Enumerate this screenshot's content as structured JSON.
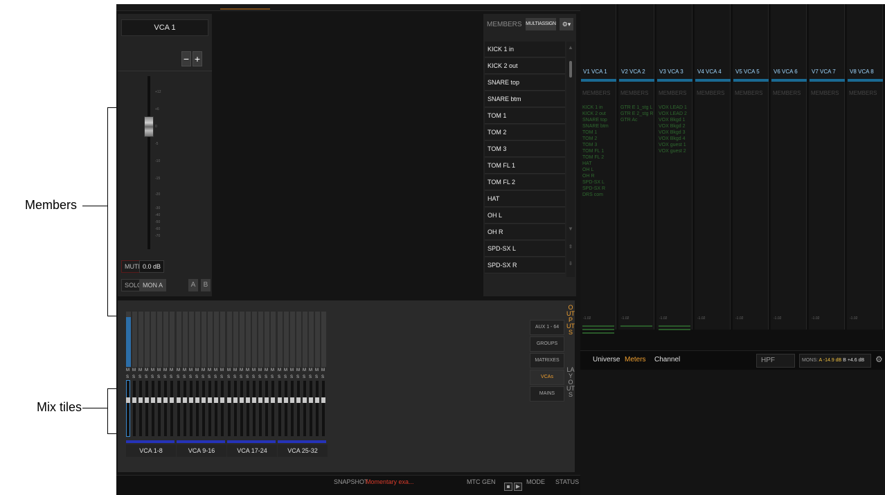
{
  "annotations": {
    "members_label": "Members",
    "mix_tiles_label": "Mix tiles"
  },
  "vca_panel": {
    "name": "VCA 1",
    "minus": "−",
    "plus": "+",
    "mute_label": "MUTE",
    "level": "0.0 dB",
    "solo_label": "SOLO",
    "mon_label": "MON A",
    "a_label": "A",
    "b_label": "B"
  },
  "members_panel": {
    "title": "MEMBERS",
    "multiassign": "MULTIASSIGN",
    "gear": "⚙▾",
    "items": [
      "KICK 1 in",
      "KICK 2 out",
      "SNARE top",
      "SNARE btm",
      "TOM 1",
      "TOM 2",
      "TOM 3",
      "TOM FL 1",
      "TOM FL 2",
      "HAT",
      "OH L",
      "OH R",
      "SPD-SX L",
      "SPD-SX R"
    ]
  },
  "vca_strips": [
    {
      "head": "V1  VCA 1",
      "members": [
        "KICK 1 in",
        "KICK 2 out",
        "SNARE top",
        "SNARE btm",
        "TOM 1",
        "TOM 2",
        "TOM 3",
        "TOM FL 1",
        "TOM FL 2",
        "HAT",
        "OH L",
        "OH R",
        "SPD-SX L",
        "SPD-SX R",
        "DRS com"
      ]
    },
    {
      "head": "V2  VCA 2",
      "members": [
        "GTR E 1_stg L",
        "GTR E 2_stg R",
        "GTR Ac"
      ]
    },
    {
      "head": "V3  VCA 3",
      "members": [
        "VOX LEAD 1",
        "VOX LEAD 2",
        "VOX Bkgd 1",
        "VOX Bkgd 2",
        "VOX Bkgd 3",
        "VOX Bkgd 4",
        "VOX guest 1",
        "VOX guest 2"
      ]
    },
    {
      "head": "V4  VCA 4",
      "members": []
    },
    {
      "head": "V5  VCA 5",
      "members": []
    },
    {
      "head": "V6  VCA 6",
      "members": []
    },
    {
      "head": "V7  VCA 7",
      "members": []
    },
    {
      "head": "V8  VCA 8",
      "members": []
    }
  ],
  "strip_members_label": "MEMBERS",
  "strip_gain": "-1.02",
  "view_bar": {
    "universe": "Universe",
    "meters": "Meters",
    "channel": "Channel",
    "hpf": "HPF",
    "mons_label": "MONS:",
    "mon_a": "A",
    "mon_a_val": "-14.9 dB",
    "mon_b": "B",
    "mon_b_val": "+4.6 dB",
    "gear": "⚙"
  },
  "mix_tiles": {
    "banks": [
      "VCA 1-8",
      "VCA 9-16",
      "VCA 17-24",
      "VCA 25-32"
    ],
    "mute_letter": "M",
    "solo_letter": "S",
    "output_buttons": [
      "AUX 1 - 64",
      "GROUPS",
      "MATRIXES",
      "VCAs",
      "MAINS"
    ],
    "outputs_tab": "OUTPUTS",
    "layouts_tab": "LAYOUTS"
  },
  "footer": {
    "snapshot_label": "SNAPSHOT",
    "snapshot_value": "Momentary exa...",
    "mtc_label": "MTC GEN",
    "mode_label": "MODE",
    "status_label": "STATUS"
  },
  "colors": {
    "accent_orange": "#f0a030",
    "head_blue": "#1a6a93",
    "member_green": "#2f6a2f",
    "snapshot_red": "#d83a2a"
  }
}
